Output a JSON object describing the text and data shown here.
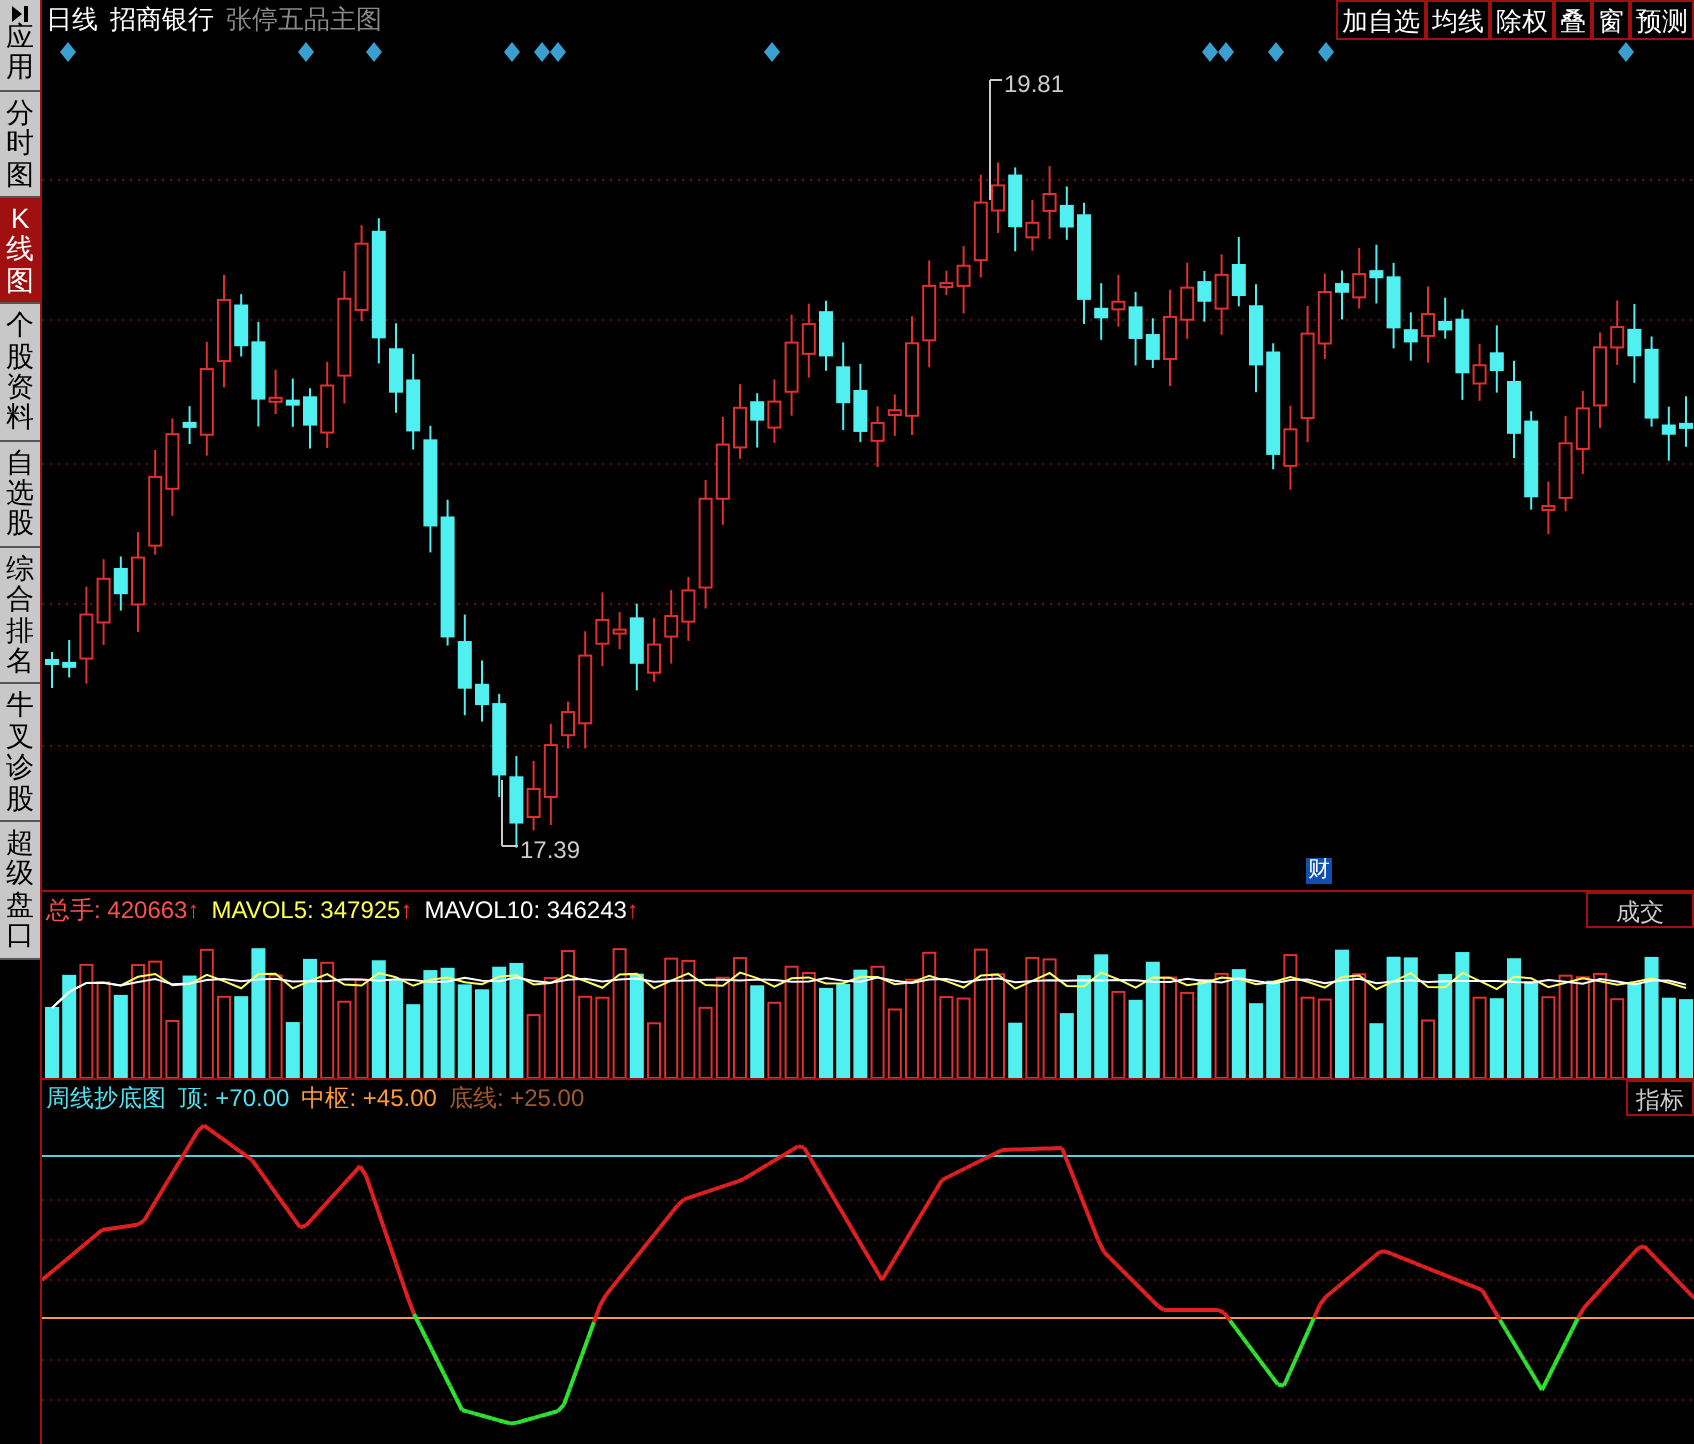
{
  "sidebar": {
    "items": [
      {
        "label": "应用",
        "kind": "icon-label",
        "selected": false
      },
      {
        "label": "分时图",
        "kind": "label",
        "selected": false
      },
      {
        "label": "K线图",
        "kind": "label",
        "selected": true
      },
      {
        "label": "个股资料",
        "kind": "label",
        "selected": false
      },
      {
        "label": "自选股",
        "kind": "label",
        "selected": false
      },
      {
        "label": "综合排名",
        "kind": "label",
        "selected": false
      },
      {
        "label": "牛叉诊股",
        "kind": "label",
        "selected": false
      },
      {
        "label": "超级盘口",
        "kind": "label",
        "selected": false
      }
    ]
  },
  "header": {
    "period": "日线",
    "stock": "招商银行",
    "template": "张停五品主图",
    "toolbar": [
      "加自选",
      "均线",
      "除权",
      "叠",
      "窗",
      "预测"
    ]
  },
  "price_chart": {
    "high_label": "19.81",
    "low_label": "17.39",
    "marker": "财"
  },
  "volume_panel": {
    "legend": [
      {
        "text": "总手: 420663",
        "arrow": "↑",
        "color": "#ff5050"
      },
      {
        "text": "MAVOL5: 347925",
        "arrow": "↑",
        "color": "#ffff50"
      },
      {
        "text": "MAVOL10: 346243",
        "arrow": "↑",
        "color": "#ffffff"
      }
    ],
    "tab": "成交"
  },
  "indicator_panel": {
    "title": "周线抄底图",
    "legend": [
      {
        "text": "顶: +70.00",
        "color": "#50e0f0"
      },
      {
        "text": "中枢: +45.00",
        "color": "#ff9a40"
      },
      {
        "text": "底线: +25.00",
        "color": "#a05a30"
      }
    ],
    "tab": "指标"
  }
}
